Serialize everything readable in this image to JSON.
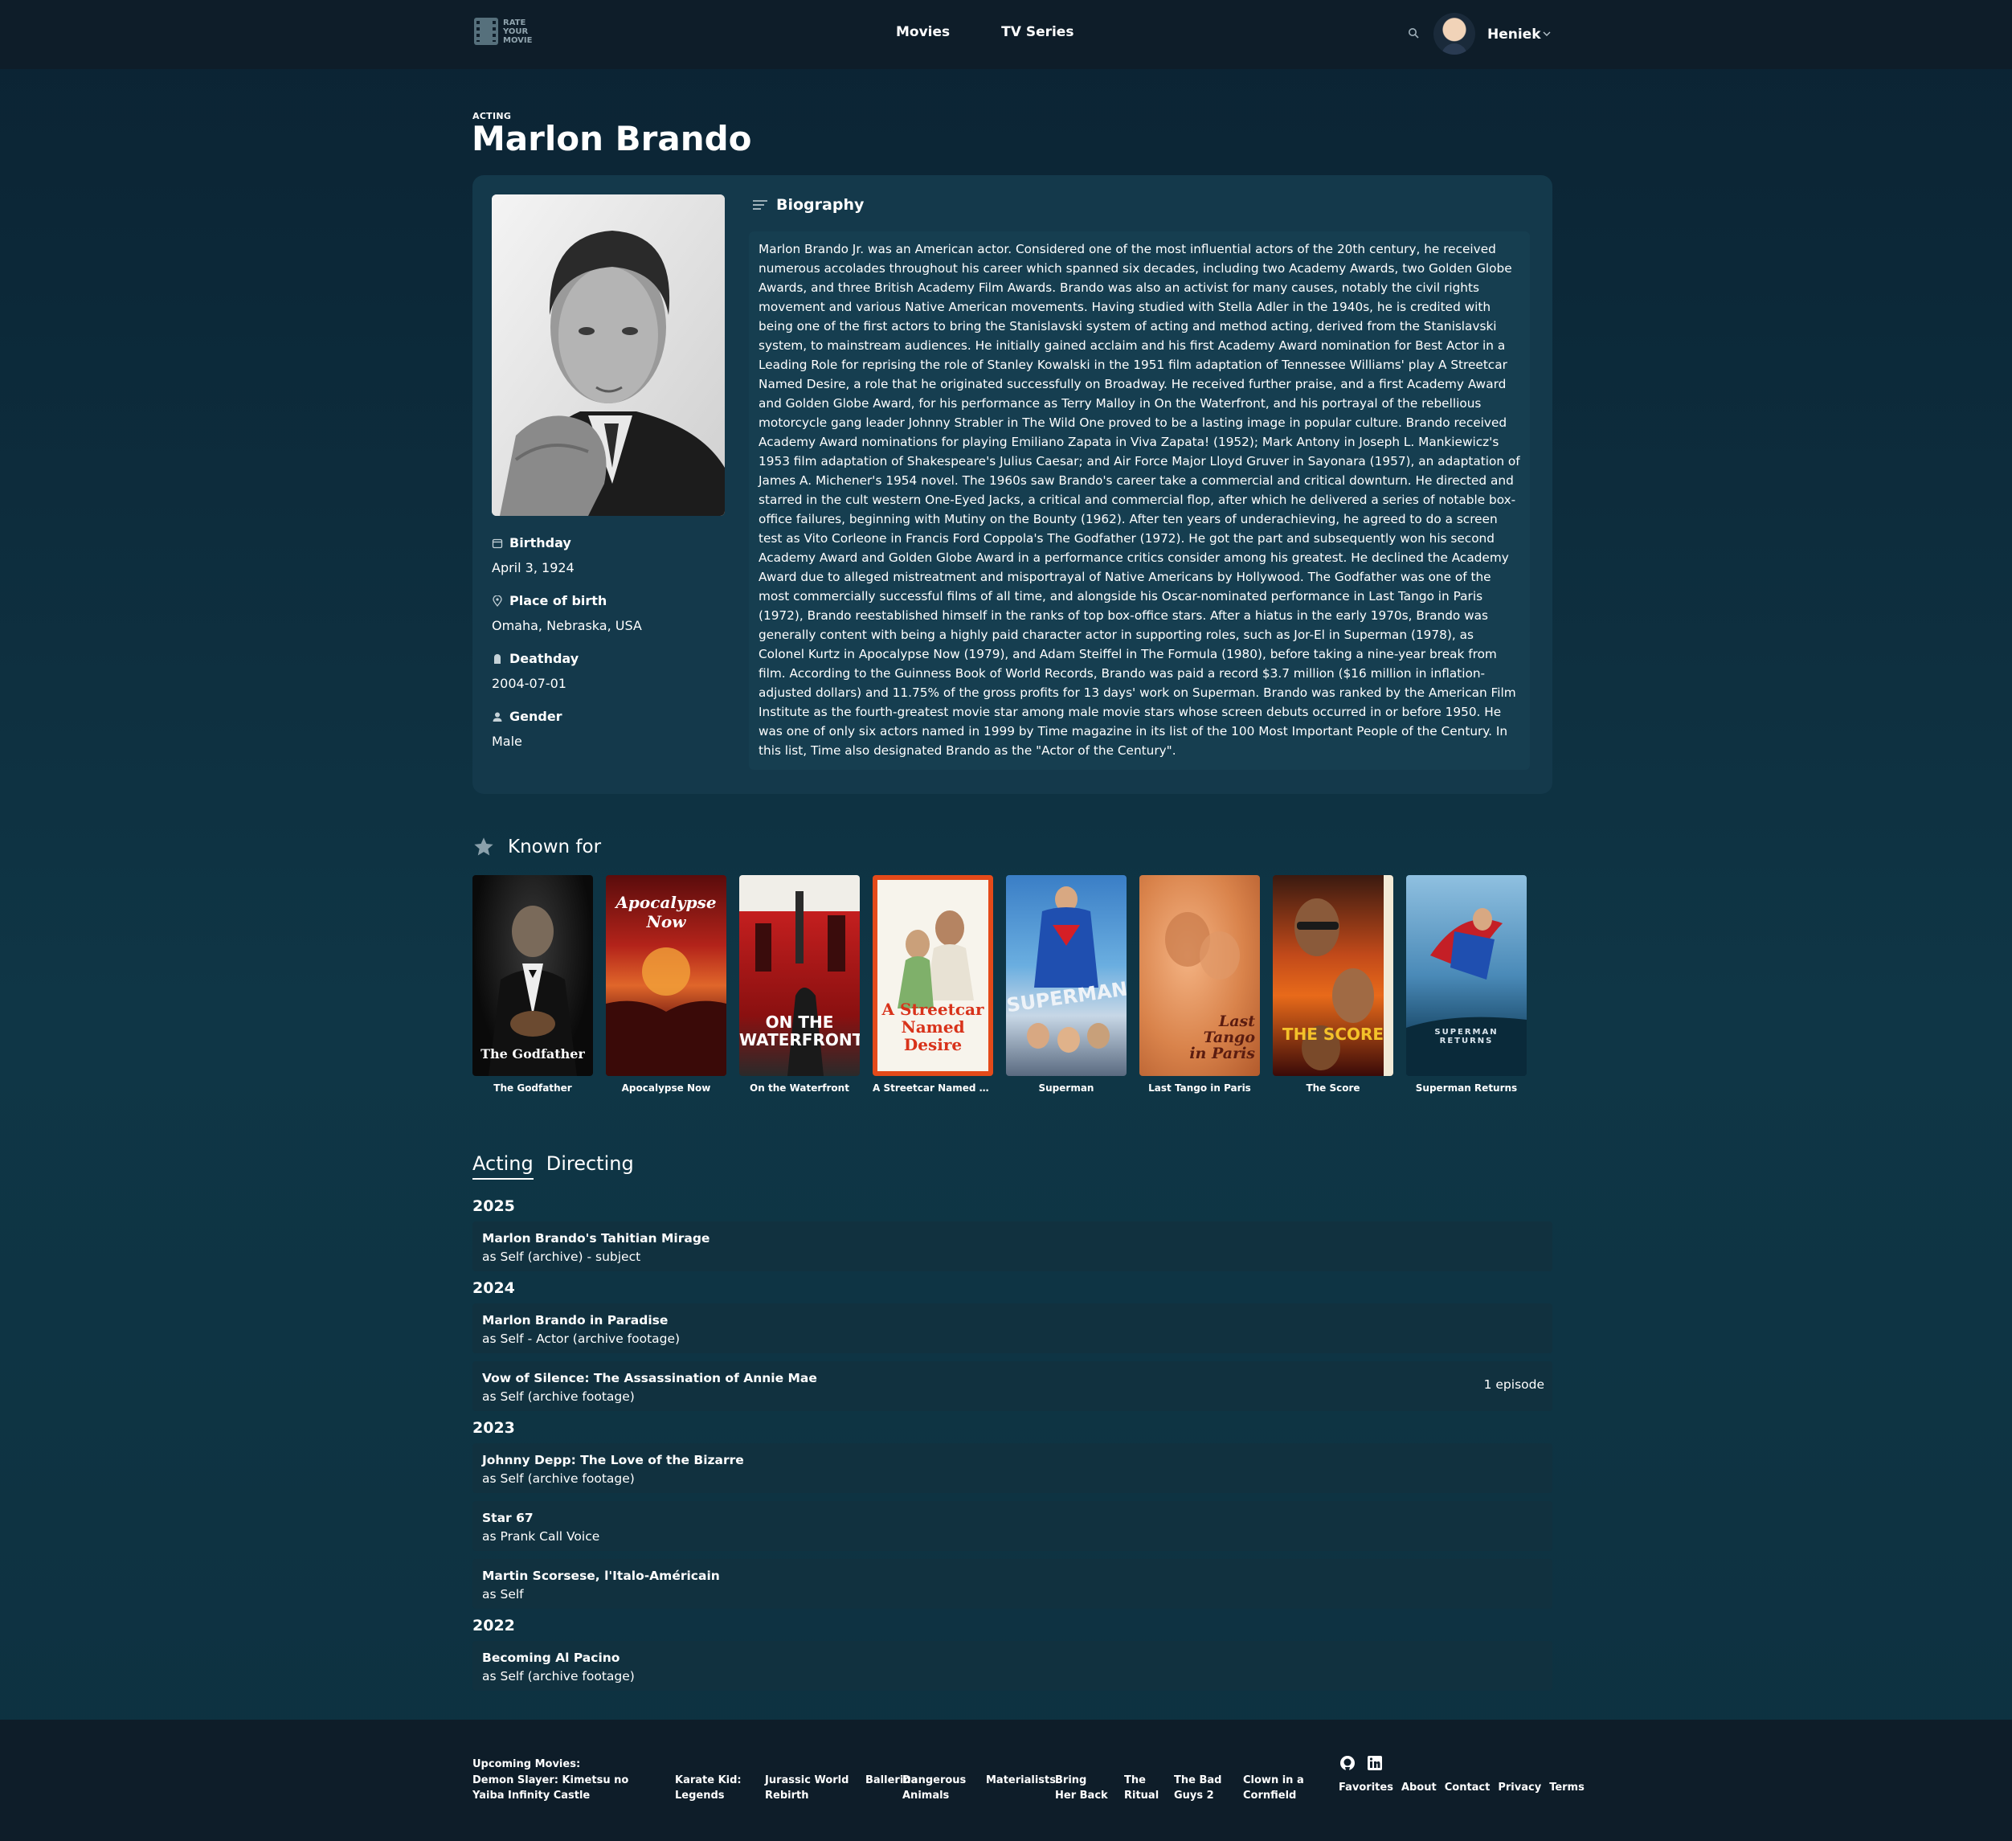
{
  "nav": {
    "logo_text": "RATE YOUR MOVIE",
    "links": [
      "Movies",
      "TV Series"
    ],
    "user_name": "Heniek"
  },
  "person": {
    "department": "ACTING",
    "name": "Marlon Brando",
    "biography_label": "Biography",
    "biography": "Marlon Brando Jr. was an American actor. Considered one of the most influential actors of the 20th century, he received numerous accolades throughout his career which spanned six decades, including two Academy Awards, two Golden Globe Awards, and three British Academy Film Awards. Brando was also an activist for many causes, notably the civil rights movement and various Native American movements. Having studied with Stella Adler in the 1940s, he is credited with being one of the first actors to bring the Stanislavski system of acting and method acting, derived from the Stanislavski system, to mainstream audiences. He initially gained acclaim and his first Academy Award nomination for Best Actor in a Leading Role for reprising the role of Stanley Kowalski in the 1951 film adaptation of Tennessee Williams' play A Streetcar Named Desire, a role that he originated successfully on Broadway. He received further praise, and a first Academy Award and Golden Globe Award, for his performance as Terry Malloy in On the Waterfront, and his portrayal of the rebellious motorcycle gang leader Johnny Strabler in The Wild One proved to be a lasting image in popular culture. Brando received Academy Award nominations for playing Emiliano Zapata in Viva Zapata! (1952); Mark Antony in Joseph L. Mankiewicz's 1953 film adaptation of Shakespeare's Julius Caesar; and Air Force Major Lloyd Gruver in Sayonara (1957), an adaptation of James A. Michener's 1954 novel. The 1960s saw Brando's career take a commercial and critical downturn. He directed and starred in the cult western One-Eyed Jacks, a critical and commercial flop, after which he delivered a series of notable box-office failures, beginning with Mutiny on the Bounty (1962). After ten years of underachieving, he agreed to do a screen test as Vito Corleone in Francis Ford Coppola's The Godfather (1972). He got the part and subsequently won his second Academy Award and Golden Globe Award in a performance critics consider among his greatest. He declined the Academy Award due to alleged mistreatment and misportrayal of Native Americans by Hollywood. The Godfather was one of the most commercially successful films of all time, and alongside his Oscar-nominated performance in Last Tango in Paris (1972), Brando reestablished himself in the ranks of top box-office stars. After a hiatus in the early 1970s, Brando was generally content with being a highly paid character actor in supporting roles, such as Jor-El in Superman (1978), as Colonel Kurtz in Apocalypse Now (1979), and Adam Steiffel in The Formula (1980), before taking a nine-year break from film. According to the Guinness Book of World Records, Brando was paid a record $3.7 million ($16 million in inflation-adjusted dollars) and 11.75% of the gross profits for 13 days' work on Superman. Brando was ranked by the American Film Institute as the fourth-greatest movie star among male movie stars whose screen debuts occurred in or before 1950. He was one of only six actors named in 1999 by Time magazine in its list of the 100 Most Important People of the Century. In this list, Time also designated Brando as the \"Actor of the Century\".",
    "facts": [
      {
        "label": "Birthday",
        "value": "April 3, 1924",
        "icon": "calendar-icon"
      },
      {
        "label": "Place of birth",
        "value": "Omaha, Nebraska, USA",
        "icon": "location-pin-icon"
      },
      {
        "label": "Deathday",
        "value": "2004-07-01",
        "icon": "tombstone-icon"
      },
      {
        "label": "Gender",
        "value": "Male",
        "icon": "person-icon"
      }
    ]
  },
  "known_for": {
    "heading": "Known for",
    "movies": [
      {
        "title": "The Godfather",
        "poster_text": "The Godfather"
      },
      {
        "title": "Apocalypse Now",
        "poster_text": "Apocalypse Now"
      },
      {
        "title": "On the Waterfront",
        "poster_text": "ON THE WATERFRONT"
      },
      {
        "title": "A Streetcar Named Des...",
        "poster_text": "A Streetcar Named Desire"
      },
      {
        "title": "Superman",
        "poster_text": "SUPERMAN"
      },
      {
        "title": "Last Tango in Paris",
        "poster_text": "Last Tango in Paris"
      },
      {
        "title": "The Score",
        "poster_text": "THE SCORE"
      },
      {
        "title": "Superman Returns",
        "poster_text": "SUPERMAN RETURNS"
      }
    ]
  },
  "credits": {
    "tabs": [
      "Acting",
      "Directing"
    ],
    "active_tab": "Acting",
    "years": [
      {
        "year": "2025",
        "items": [
          {
            "title": "Marlon Brando's Tahitian Mirage",
            "role": "as Self (archive) - subject",
            "episodes": ""
          }
        ]
      },
      {
        "year": "2024",
        "items": [
          {
            "title": "Marlon Brando in Paradise",
            "role": "as Self - Actor (archive footage)",
            "episodes": ""
          },
          {
            "title": "Vow of Silence: The Assassination of Annie Mae",
            "role": "as Self (archive footage)",
            "episodes": "1 episode"
          }
        ]
      },
      {
        "year": "2023",
        "items": [
          {
            "title": "Johnny Depp: The Love of the Bizarre",
            "role": "as Self (archive footage)",
            "episodes": ""
          },
          {
            "title": "Star 67",
            "role": "as Prank Call Voice",
            "episodes": ""
          },
          {
            "title": "Martin Scorsese, l'Italo-Américain",
            "role": "as Self",
            "episodes": ""
          }
        ]
      },
      {
        "year": "2022",
        "items": [
          {
            "title": "Becoming Al Pacino",
            "role": "as Self (archive footage)",
            "episodes": ""
          }
        ]
      }
    ]
  },
  "footer": {
    "upcoming_label": "Upcoming Movies:",
    "upcoming": [
      "Demon Slayer: Kimetsu no Yaiba Infinity Castle",
      "Karate Kid: Legends",
      "Jurassic World Rebirth",
      "Ballerina",
      "Dangerous Animals",
      "Materialists",
      "Bring Her Back",
      "The Ritual",
      "The Bad Guys 2",
      "Clown in a Cornfield"
    ],
    "links": [
      "Favorites",
      "About",
      "Contact",
      "Privacy",
      "Terms"
    ]
  }
}
